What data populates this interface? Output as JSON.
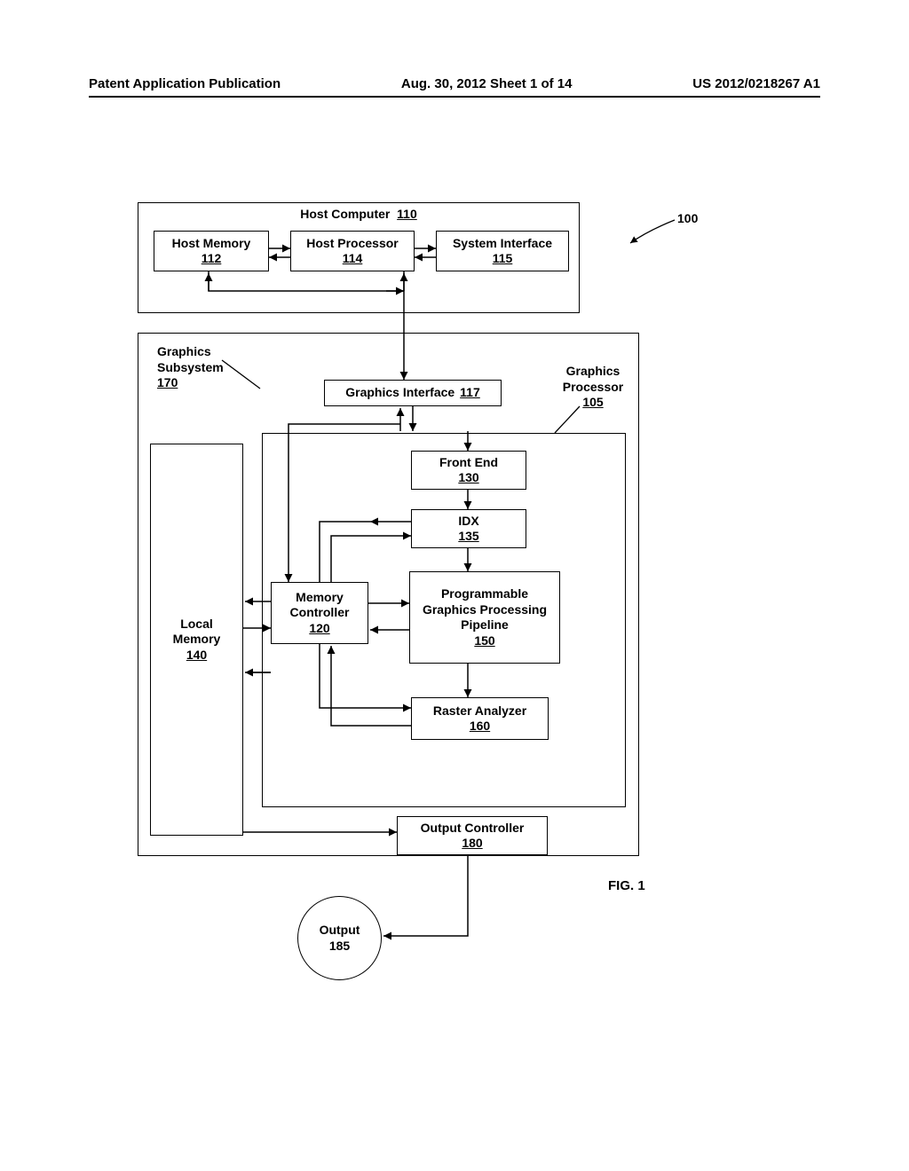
{
  "header": {
    "left": "Patent Application Publication",
    "center": "Aug. 30, 2012  Sheet 1 of 14",
    "right": "US 2012/0218267 A1"
  },
  "system_ref": "100",
  "blocks": {
    "host_computer": {
      "label": "Host Computer",
      "num": "110"
    },
    "host_memory": {
      "label": "Host Memory",
      "num": "112"
    },
    "host_processor": {
      "label": "Host Processor",
      "num": "114"
    },
    "system_interface": {
      "label": "System Interface",
      "num": "115"
    },
    "graphics_subsystem": {
      "label": "Graphics Subsystem",
      "num": "170"
    },
    "graphics_processor": {
      "label": "Graphics Processor",
      "num": "105"
    },
    "graphics_interface": {
      "label": "Graphics Interface",
      "num": "117"
    },
    "front_end": {
      "label": "Front End",
      "num": "130"
    },
    "idx": {
      "label": "IDX",
      "num": "135"
    },
    "pipeline": {
      "label": "Programmable Graphics Processing Pipeline",
      "num": "150"
    },
    "raster_analyzer": {
      "label": "Raster Analyzer",
      "num": "160"
    },
    "memory_controller": {
      "label": "Memory Controller",
      "num": "120"
    },
    "local_memory": {
      "label": "Local Memory",
      "num": "140"
    },
    "output_controller": {
      "label": "Output Controller",
      "num": "180"
    },
    "output": {
      "label": "Output",
      "num": "185"
    }
  },
  "figure_label": "FIG. 1"
}
